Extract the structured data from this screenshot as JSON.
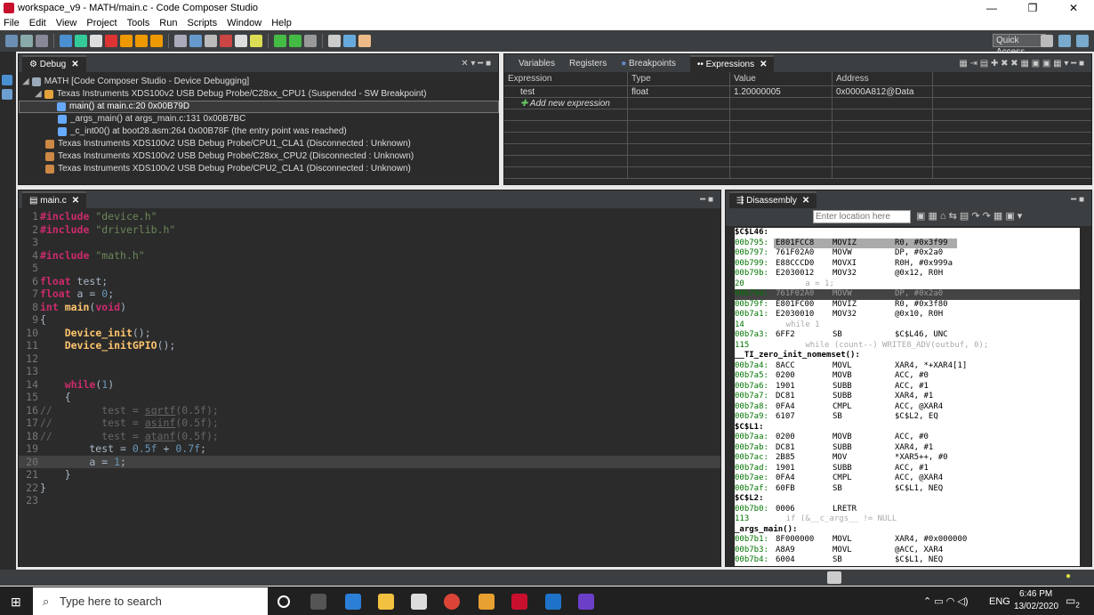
{
  "window": {
    "title": "workspace_v9 - MATH/main.c - Code Composer Studio",
    "minimize": "—",
    "restore": "❐",
    "close": "✕"
  },
  "menu": [
    "File",
    "Edit",
    "View",
    "Project",
    "Tools",
    "Run",
    "Scripts",
    "Window",
    "Help"
  ],
  "quick_access": "Quick Access",
  "debug": {
    "tab": "Debug",
    "items": [
      {
        "label": "MATH [Code Composer Studio - Device Debugging]",
        "indent": 1
      },
      {
        "label": "Texas Instruments XDS100v2 USB Debug Probe/C28xx_CPU1 (Suspended - SW Breakpoint)",
        "indent": 2
      },
      {
        "label": "main() at main.c:20 0x00B79D",
        "indent": 3,
        "selected": true
      },
      {
        "label": "_args_main() at args_main.c:131 0x00B7BC",
        "indent": 3
      },
      {
        "label": "_c_int00() at boot28.asm:264 0x00B78F  (the entry point was reached)",
        "indent": 3
      },
      {
        "label": "Texas Instruments XDS100v2 USB Debug Probe/CPU1_CLA1 (Disconnected : Unknown)",
        "indent": 2
      },
      {
        "label": "Texas Instruments XDS100v2 USB Debug Probe/C28xx_CPU2 (Disconnected : Unknown)",
        "indent": 2
      },
      {
        "label": "Texas Instruments XDS100v2 USB Debug Probe/CPU2_CLA1 (Disconnected : Unknown)",
        "indent": 2
      }
    ]
  },
  "views_tabs": {
    "variables": "Variables",
    "registers": "Registers",
    "breakpoints": "Breakpoints",
    "expressions": "Expressions"
  },
  "expressions": {
    "headers": [
      "Expression",
      "Type",
      "Value",
      "Address"
    ],
    "rows": [
      [
        "test",
        "float",
        "1.20000005",
        "0x0000A812@Data"
      ]
    ],
    "add": "Add new expression"
  },
  "editor": {
    "tab": "main.c",
    "lines": [
      {
        "n": "1",
        "h": "<span class='kw'>#include</span> <span class='str'>\"device.h\"</span>"
      },
      {
        "n": "2",
        "h": "<span class='kw'>#include</span> <span class='str'>\"driverlib.h\"</span>"
      },
      {
        "n": "3",
        "h": ""
      },
      {
        "n": "4",
        "h": "<span class='kw'>#include</span> <span class='str'>\"math.h\"</span>"
      },
      {
        "n": "5",
        "h": ""
      },
      {
        "n": "6",
        "h": "<span class='kw'>float</span> test;"
      },
      {
        "n": "7",
        "h": "<span class='kw'>float</span> a = <span class='num'>0</span>;"
      },
      {
        "n": "8",
        "h": "<span class='kw'>int</span> <span class='fn'>main</span>(<span class='kw'>void</span>)"
      },
      {
        "n": "9",
        "h": "{"
      },
      {
        "n": "10",
        "h": "    <span class='fn'>Device_init</span>();"
      },
      {
        "n": "11",
        "h": "    <span class='fn'>Device_initGPIO</span>();"
      },
      {
        "n": "12",
        "h": ""
      },
      {
        "n": "13",
        "h": ""
      },
      {
        "n": "14",
        "h": "    <span class='kw'>while</span>(<span class='num'>1</span>)"
      },
      {
        "n": "15",
        "h": "    {"
      },
      {
        "n": "16",
        "h": "<span class='cm'>//        test = <u>sqrtf</u>(0.5f);</span>"
      },
      {
        "n": "17",
        "h": "<span class='cm'>//        test = <u>asinf</u>(0.5f);</span>"
      },
      {
        "n": "18",
        "h": "<span class='cm'>//        test = <u>atanf</u>(0.5f);</span>"
      },
      {
        "n": "19",
        "h": "        test = <span class='num'>0.5f</span> + <span class='num'>0.7f</span>;"
      },
      {
        "n": "20",
        "h": "        a = <span class='num'>1</span>;",
        "hl": true
      },
      {
        "n": "21",
        "h": "    }"
      },
      {
        "n": "22",
        "h": "}"
      },
      {
        "n": "23",
        "h": ""
      }
    ]
  },
  "disassembly": {
    "tab": "Disassembly",
    "location_placeholder": "Enter location here",
    "rows": [
      [
        "label",
        "$C$L46:"
      ],
      [
        "hl1",
        "00b795:",
        "E801FCC8",
        "MOVIZ",
        "R0, #0x3f99"
      ],
      [
        "i",
        "00b797:",
        "761F02A0",
        "MOVW",
        "DP, #0x2a0"
      ],
      [
        "i",
        "00b799:",
        "E88CCCD0",
        "MOVXI",
        "R0H, #0x999a"
      ],
      [
        "i",
        "00b79b:",
        "E2030012",
        "MOV32",
        "@0x12, R0H"
      ],
      [
        "src",
        "20",
        "",
        "        a = 1;"
      ],
      [
        "cur",
        "00b79d:",
        "761F02A0",
        "MOVW",
        "DP, #0x2a0"
      ],
      [
        "i",
        "00b79f:",
        "E801FC00",
        "MOVIZ",
        "R0, #0x3f80"
      ],
      [
        "i",
        "00b7a1:",
        "E2030010",
        "MOV32",
        "@0x10, R0H"
      ],
      [
        "src",
        "14",
        "",
        "    while 1"
      ],
      [
        "i",
        "00b7a3:",
        "6FF2",
        "SB",
        "$C$L46, UNC"
      ],
      [
        "src",
        "115",
        "",
        "        while (count--) WRITE8_ADV(outbuf, 0);"
      ],
      [
        "label",
        "__TI_zero_init_nomemset():"
      ],
      [
        "i",
        "00b7a4:",
        "8ACC",
        "MOVL",
        "XAR4, *+XAR4[1]"
      ],
      [
        "i",
        "00b7a5:",
        "0200",
        "MOVB",
        "ACC, #0"
      ],
      [
        "i",
        "00b7a6:",
        "1901",
        "SUBB",
        "ACC, #1"
      ],
      [
        "i",
        "00b7a7:",
        "DC81",
        "SUBB",
        "XAR4, #1"
      ],
      [
        "i",
        "00b7a8:",
        "0FA4",
        "CMPL",
        "ACC, @XAR4"
      ],
      [
        "i",
        "00b7a9:",
        "6107",
        "SB",
        "$C$L2, EQ"
      ],
      [
        "label",
        "$C$L1:"
      ],
      [
        "i",
        "00b7aa:",
        "0200",
        "MOVB",
        "ACC, #0"
      ],
      [
        "i",
        "00b7ab:",
        "DC81",
        "SUBB",
        "XAR4, #1"
      ],
      [
        "i",
        "00b7ac:",
        "2B85",
        "MOV",
        "*XAR5++, #0"
      ],
      [
        "i",
        "00b7ad:",
        "1901",
        "SUBB",
        "ACC, #1"
      ],
      [
        "i",
        "00b7ae:",
        "0FA4",
        "CMPL",
        "ACC, @XAR4"
      ],
      [
        "i",
        "00b7af:",
        "60FB",
        "SB",
        "$C$L1, NEQ"
      ],
      [
        "label",
        "$C$L2:"
      ],
      [
        "i",
        "00b7b0:",
        "0006",
        "LRETR",
        ""
      ],
      [
        "src",
        "113",
        "",
        "    if (&__c_args__ != NULL"
      ],
      [
        "label",
        "_args_main():"
      ],
      [
        "i",
        "00b7b1:",
        "8F000000",
        "MOVL",
        "XAR4, #0x000000"
      ],
      [
        "i",
        "00b7b3:",
        "A8A9",
        "MOVL",
        "@ACC, XAR4"
      ],
      [
        "i",
        "00b7b4:",
        "6004",
        "SB",
        "$C$L1, NEQ"
      ]
    ]
  },
  "taskbar": {
    "search": "Type here to search",
    "time": "6:46 PM",
    "date": "13/02/2020",
    "lang": "ENG",
    "notif": "2"
  }
}
